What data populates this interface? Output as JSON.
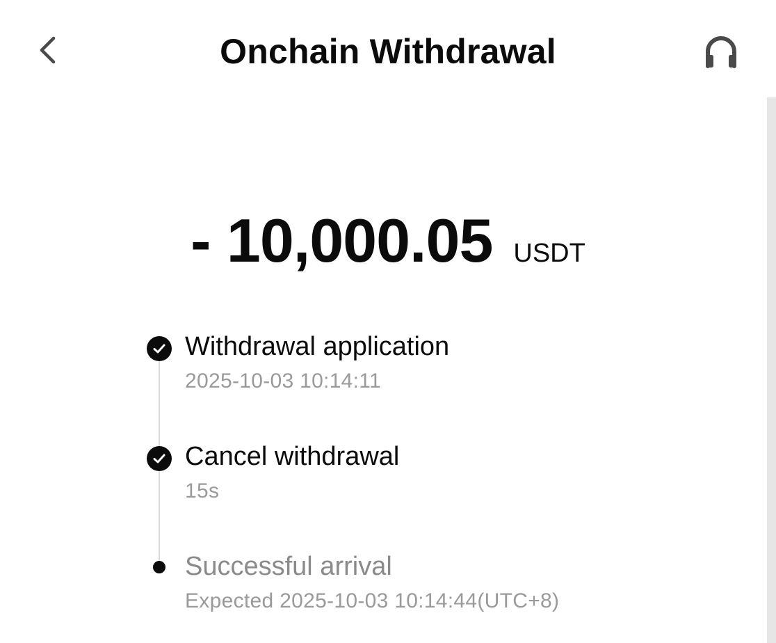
{
  "header": {
    "title": "Onchain Withdrawal",
    "back_icon": "chevron-left-icon",
    "support_icon": "headset-icon"
  },
  "amount": {
    "value": "- 10,000.05",
    "unit": "USDT"
  },
  "timeline": {
    "steps": [
      {
        "title": "Withdrawal application",
        "subtitle": "2025-10-03 10:14:11",
        "status": "completed",
        "icon": "check-circle-icon"
      },
      {
        "title": "Cancel withdrawal",
        "subtitle": "15s",
        "status": "completed",
        "icon": "check-circle-icon"
      },
      {
        "title": "Successful arrival",
        "subtitle": "Expected 2025-10-03 10:14:44(UTC+8)",
        "status": "pending",
        "icon": "dot-icon"
      }
    ]
  },
  "colors": {
    "text_primary": "#0b0b0b",
    "text_muted": "#8a8a8a",
    "subtext": "#9a9a9a",
    "timeline_line": "#dcdcdc",
    "scrollbar": "#e6e6e6",
    "icon_gray": "#4a4a4a"
  }
}
